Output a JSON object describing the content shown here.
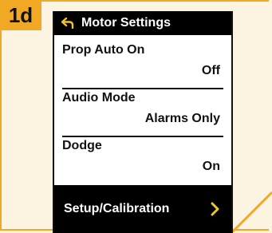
{
  "step": "1d",
  "header": {
    "title": "Motor Settings",
    "back_icon": "back-arrow-icon"
  },
  "items": [
    {
      "label": "Prop Auto On",
      "value": "Off"
    },
    {
      "label": "Audio Mode",
      "value": "Alarms Only"
    },
    {
      "label": "Dodge",
      "value": "On"
    }
  ],
  "setup": {
    "label": "Setup/Calibration",
    "icon": "chevron-right-icon"
  },
  "colors": {
    "accent": "#f1a824",
    "background": "#fdf3e1",
    "screen": "#ffffff",
    "bar": "#000000",
    "chevron": "#f1c232"
  }
}
